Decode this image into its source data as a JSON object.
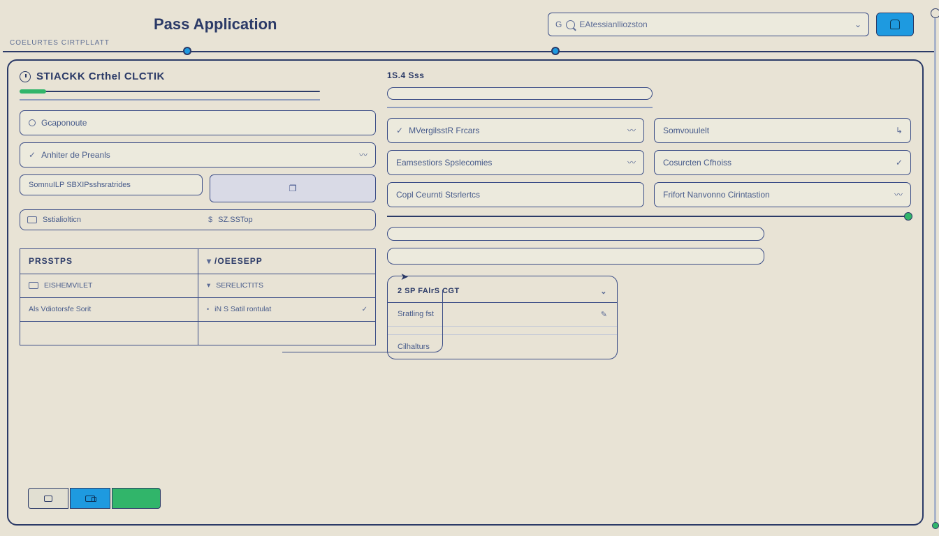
{
  "header": {
    "title": "Pass Application",
    "breadcrumb": "COELURTES CIRTPLLATT",
    "search_placeholder": "EAtessianlliozston",
    "search_prefix": "G"
  },
  "left": {
    "section_title": "STIACKK Crthel CLCTIK",
    "fields": {
      "f1": "Gcaponoute",
      "f2": "Anhiter de Preanls",
      "f3": "SomnuILP SBXIPsshsratrides"
    },
    "mini": {
      "a": "Sstialiolticn",
      "b": "SZ.SSTop"
    },
    "table": {
      "h1": "PRSSTPS",
      "h2": "/OEESEPP",
      "r1a": "EISHEMVILET",
      "r1b": "SERELICTITS",
      "r2a": "Als Vdiotorsfe Sorit",
      "r2b": "iN S Satil rontulat"
    }
  },
  "right": {
    "section_num": "1S.4 Sss",
    "row1": {
      "a": "MVergilsstR Frcars",
      "b": "Somvouulelt"
    },
    "row2": {
      "a": "Eamsestiors Spslecomies",
      "b": "Cosurcten Cfhoiss"
    },
    "row3": {
      "a": "Copl Ceurnti Stsrlertcs",
      "b": "Frifort Nanvonno Cirintastion"
    },
    "panel": {
      "hdr": "2 SP FAlrS CGT",
      "r1": "Sratling fst",
      "r2": "Cilhalturs"
    }
  }
}
